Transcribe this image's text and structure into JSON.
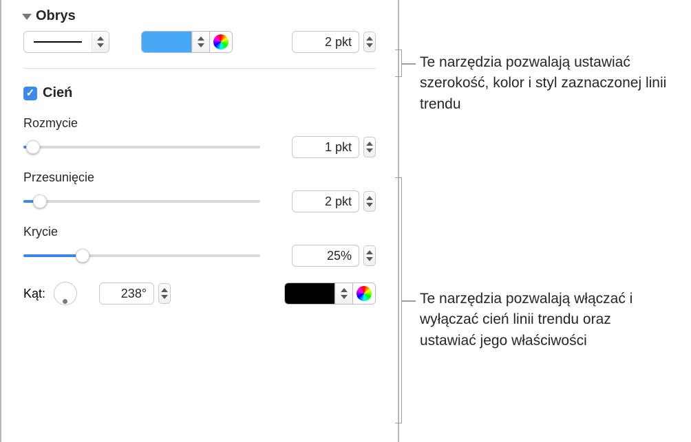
{
  "stroke": {
    "section_title": "Obrys",
    "width_value": "2 pkt",
    "color": "#47a8f5"
  },
  "shadow": {
    "section_title": "Cień",
    "blur_label": "Rozmycie",
    "blur_value": "1 pkt",
    "blur_percent": 4,
    "offset_label": "Przesunięcie",
    "offset_value": "2 pkt",
    "offset_percent": 7,
    "opacity_label": "Krycie",
    "opacity_value": "25%",
    "opacity_percent": 25,
    "angle_label": "Kąt:",
    "angle_value": "238°",
    "shadow_color": "#000000"
  },
  "callouts": {
    "stroke_text": "Te narzędzia pozwalają ustawiać szerokość, kolor i styl zaznaczonej linii trendu",
    "shadow_text": "Te narzędzia pozwalają włączać i wyłączać cień linii trendu oraz ustawiać jego właściwości"
  }
}
